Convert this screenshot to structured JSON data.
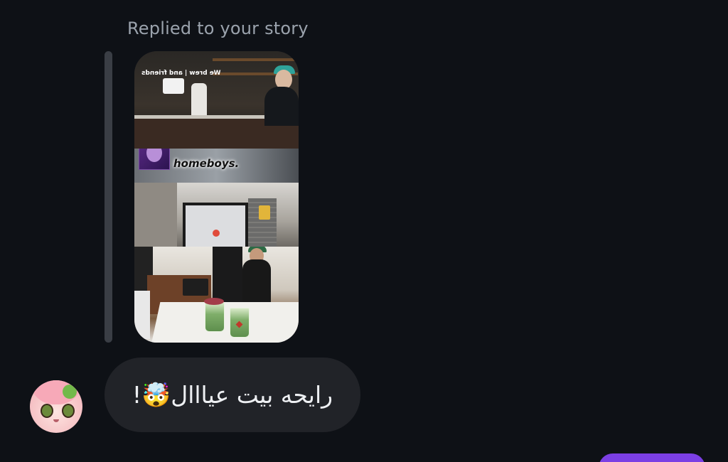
{
  "thread": {
    "reply_context": "Replied to your story",
    "story": {
      "sign_text": "We brew | and friends",
      "brand": "homeboys."
    },
    "message": {
      "text": "رايحه بيت عيااال🤯!"
    }
  },
  "colors": {
    "background": "#0e1116",
    "bubble": "#212328",
    "outgoing_bubble": "#7b3fe4",
    "label": "#9ba3ad"
  }
}
